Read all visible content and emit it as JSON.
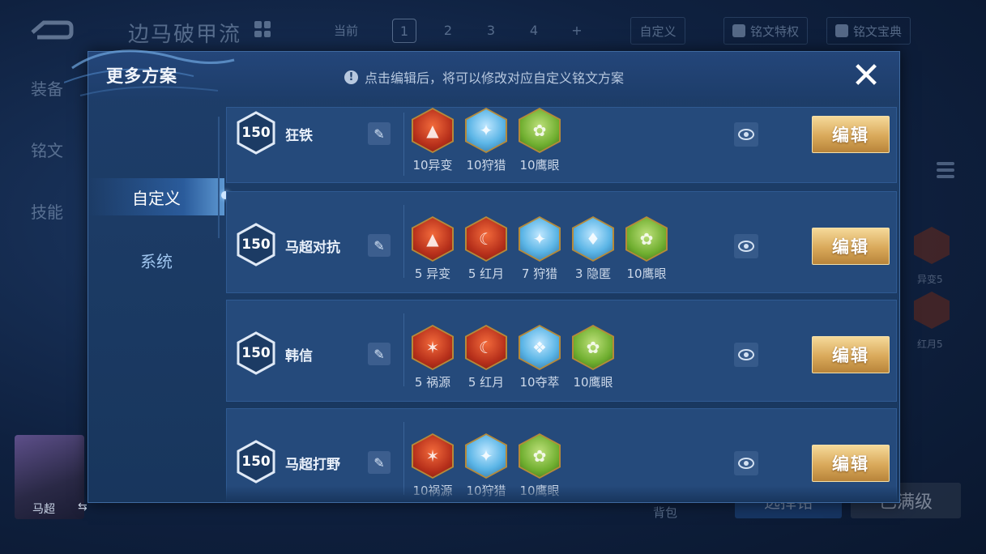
{
  "background": {
    "title": "边马破甲流",
    "current_label": "当前",
    "tabs": [
      "1",
      "2",
      "3",
      "4",
      "+"
    ],
    "active_tab": "1",
    "custom_label": "自定义",
    "privilege_label": "铭文特权",
    "guide_label": "铭文宝典",
    "left_menu": [
      "装备",
      "铭文",
      "技能"
    ],
    "rune_labels": [
      "异变5",
      "红月5"
    ],
    "hero_name": "马超",
    "bag_label": "背包",
    "recommend_label": "选择铭",
    "max_label": "已满级"
  },
  "modal": {
    "title": "更多方案",
    "hint_icon": "!",
    "hint": "点击编辑后，将可以修改对应自定义铭文方案",
    "close_glyph": "✕",
    "side_nav": [
      "自定义",
      "系统"
    ],
    "active_nav": "自定义",
    "edit_label": "编辑",
    "pen_glyph": "✎",
    "plans": [
      {
        "level": "150",
        "name": "狂铁",
        "runes": [
          {
            "label": "10异变",
            "color": "red",
            "glyph": "▲"
          },
          {
            "label": "10狩猎",
            "color": "blue",
            "glyph": "✦"
          },
          {
            "label": "10鹰眼",
            "color": "green",
            "glyph": "✿"
          }
        ]
      },
      {
        "level": "150",
        "name": "马超对抗",
        "runes": [
          {
            "label": "5 异变",
            "color": "red",
            "glyph": "▲"
          },
          {
            "label": "5 红月",
            "color": "red",
            "glyph": "☾"
          },
          {
            "label": "7 狩猎",
            "color": "blue",
            "glyph": "✦"
          },
          {
            "label": "3 隐匿",
            "color": "blue",
            "glyph": "♦"
          },
          {
            "label": "10鹰眼",
            "color": "green",
            "glyph": "✿"
          }
        ]
      },
      {
        "level": "150",
        "name": "韩信",
        "runes": [
          {
            "label": "5 祸源",
            "color": "red",
            "glyph": "✶"
          },
          {
            "label": "5 红月",
            "color": "red",
            "glyph": "☾"
          },
          {
            "label": "10夺萃",
            "color": "blue",
            "glyph": "❖"
          },
          {
            "label": "10鹰眼",
            "color": "green",
            "glyph": "✿"
          }
        ]
      },
      {
        "level": "150",
        "name": "马超打野",
        "runes": [
          {
            "label": "10祸源",
            "color": "red",
            "glyph": "✶"
          },
          {
            "label": "10狩猎",
            "color": "blue",
            "glyph": "✦"
          },
          {
            "label": "10鹰眼",
            "color": "green",
            "glyph": "✿"
          }
        ]
      }
    ]
  },
  "colors": {
    "accent_gold": "#d9a95a",
    "panel": "#18365d",
    "row": "#254a7b"
  }
}
